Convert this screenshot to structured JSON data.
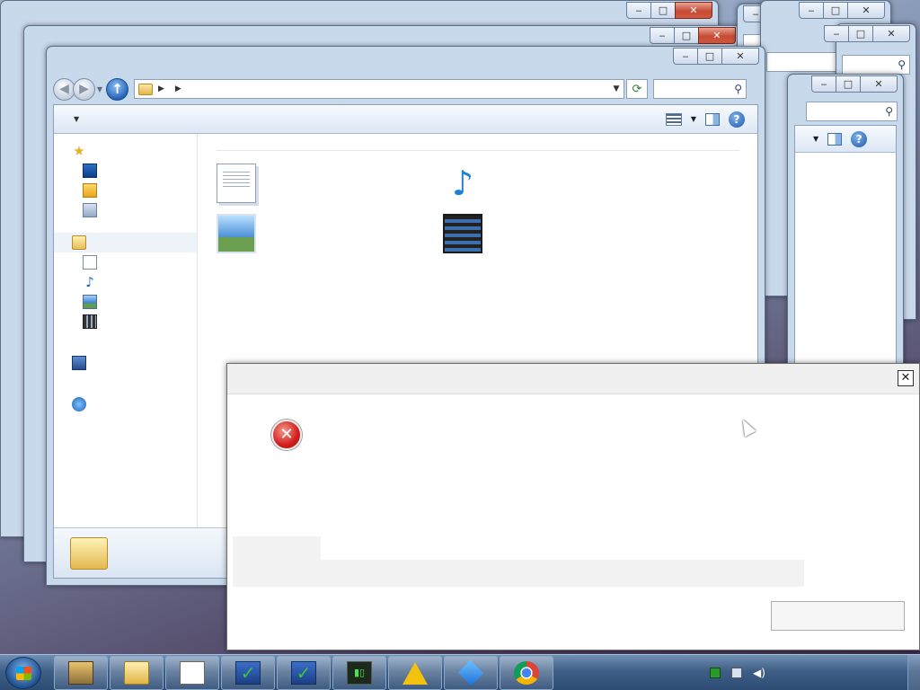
{
  "window_title": "",
  "background_windows": [
    {
      "search_placeholder": ""
    },
    {
      "search_placeholder": ""
    },
    {
      "search_placeholder": ""
    },
    {
      "search_placeholder": "",
      "hint": ""
    }
  ],
  "explorer": {
    "breadcrumb": "",
    "search_placeholder": "",
    "toolbar": {
      "organize_label": "",
      "share_label": ""
    },
    "nav": {
      "favorites_label": "",
      "favorites": [
        {
          "label": "",
          "icon": "desktop-icon"
        },
        {
          "label": "",
          "icon": "downloads-icon"
        },
        {
          "label": "",
          "icon": "recent-places-icon"
        }
      ],
      "libraries_label": "",
      "libraries": [
        {
          "label": "",
          "icon": "documents-icon"
        },
        {
          "label": "",
          "icon": "music-icon"
        },
        {
          "label": "",
          "icon": "pictures-icon"
        },
        {
          "label": "",
          "icon": "videos-icon"
        }
      ],
      "computer_label": "",
      "network_label": ""
    },
    "content": {
      "title": "",
      "subtitle": "",
      "libraries": [
        {
          "name": "",
          "desc": "",
          "icon": "documents-library-icon"
        },
        {
          "name": "",
          "desc": "",
          "icon": "music-library-icon"
        },
        {
          "name": "",
          "desc": "",
          "icon": "pictures-library-icon"
        },
        {
          "name": "",
          "desc": "",
          "icon": "videos-library-icon"
        }
      ]
    },
    "details_text": ""
  },
  "dialog": {
    "title": "",
    "message_lines": [
      "",
      "",
      "",
      ""
    ],
    "detail": "",
    "button_label": ""
  },
  "taskbar": {
    "apps": [
      "photo-app-icon",
      "explorer-folder-icon",
      "document-app-icon",
      "check-app-icon",
      "check-app-icon",
      "terminal-app-icon",
      "warning-app-icon",
      "blue-app-icon",
      "chrome-icon"
    ],
    "clock_time": "",
    "clock_date": ""
  }
}
